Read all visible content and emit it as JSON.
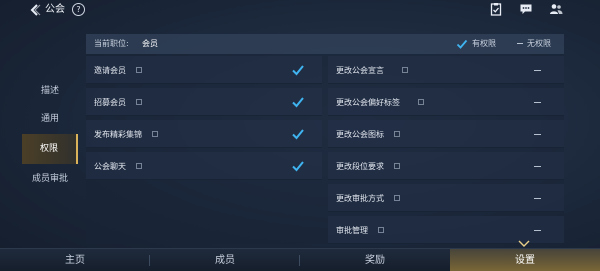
{
  "topbar": {
    "title": "公会",
    "help_glyph": "?",
    "icons": [
      "back-arrow-icon",
      "help-icon",
      "clipboard-icon",
      "chat-icon",
      "members-icon"
    ]
  },
  "sidebar": {
    "items": [
      {
        "label": "描述",
        "active": false
      },
      {
        "label": "通用",
        "active": false
      },
      {
        "label": "权限",
        "active": true
      },
      {
        "label": "成员审批",
        "active": false
      }
    ]
  },
  "panel": {
    "rank_label": "当前职位:",
    "rank_value": "会员",
    "legend_has": "有权限",
    "legend_none": "无权限",
    "left_column": [
      {
        "label": "邀请会员",
        "allowed": true
      },
      {
        "label": "招募会员",
        "allowed": true
      },
      {
        "label": "发布精彩集锦",
        "allowed": true
      },
      {
        "label": "公会聊天",
        "allowed": true
      }
    ],
    "right_column": [
      {
        "label": "更改公会宣言",
        "allowed": false
      },
      {
        "label": "更改公会偏好标签",
        "allowed": false
      },
      {
        "label": "更改公会图标",
        "allowed": false
      },
      {
        "label": "更改段位要求",
        "allowed": false
      },
      {
        "label": "更改审批方式",
        "allowed": false
      },
      {
        "label": "审批管理",
        "allowed": false
      }
    ]
  },
  "bottom_nav": {
    "items": [
      {
        "label": "主页",
        "active": false
      },
      {
        "label": "成员",
        "active": false
      },
      {
        "label": "奖励",
        "active": false
      },
      {
        "label": "设置",
        "active": true
      }
    ]
  },
  "colors": {
    "accent_check": "#3fb4f0",
    "active_gold": "#d9b25a",
    "background": "#1b273a"
  }
}
